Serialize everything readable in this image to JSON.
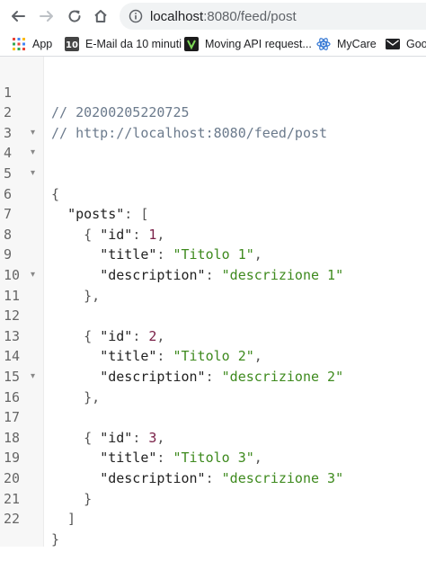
{
  "browser": {
    "url_host": "localhost",
    "url_rest": ":8080/feed/post"
  },
  "bookmarks": [
    {
      "label": "App",
      "icon": "apps-grid-icon"
    },
    {
      "label": "E-Mail da 10 minuti",
      "icon": "ten-minute-mail-icon"
    },
    {
      "label": "Moving API request...",
      "icon": "bookmark-favicon-icon"
    },
    {
      "label": "MyCare",
      "icon": "react-atom-icon"
    },
    {
      "label": "Goo",
      "icon": "mail-envelope-icon"
    }
  ],
  "colors": {
    "comment": "#6b7a8c",
    "number": "#7a2148",
    "string": "#3e8a1e",
    "gutter": "#f7f7f7"
  },
  "code": {
    "comment_timestamp": "// 20200205220725",
    "comment_url": "// http://localhost:8080/feed/post",
    "root_key": "\"posts\"",
    "id_key": "\"id\"",
    "title_key": "\"title\"",
    "description_key": "\"description\"",
    "posts": [
      {
        "id": "1",
        "title": "\"Titolo 1\"",
        "description": "\"descrizione 1\""
      },
      {
        "id": "2",
        "title": "\"Titolo 2\"",
        "description": "\"descrizione 2\""
      },
      {
        "id": "3",
        "title": "\"Titolo 3\"",
        "description": "\"descrizione 3\""
      }
    ]
  },
  "line_numbers": [
    "1",
    "2",
    "3",
    "4",
    "5",
    "6",
    "7",
    "8",
    "9",
    "10",
    "11",
    "12",
    "13",
    "14",
    "15",
    "16",
    "17",
    "18",
    "19",
    "20",
    "21",
    "22"
  ],
  "fold_marker": "▾"
}
